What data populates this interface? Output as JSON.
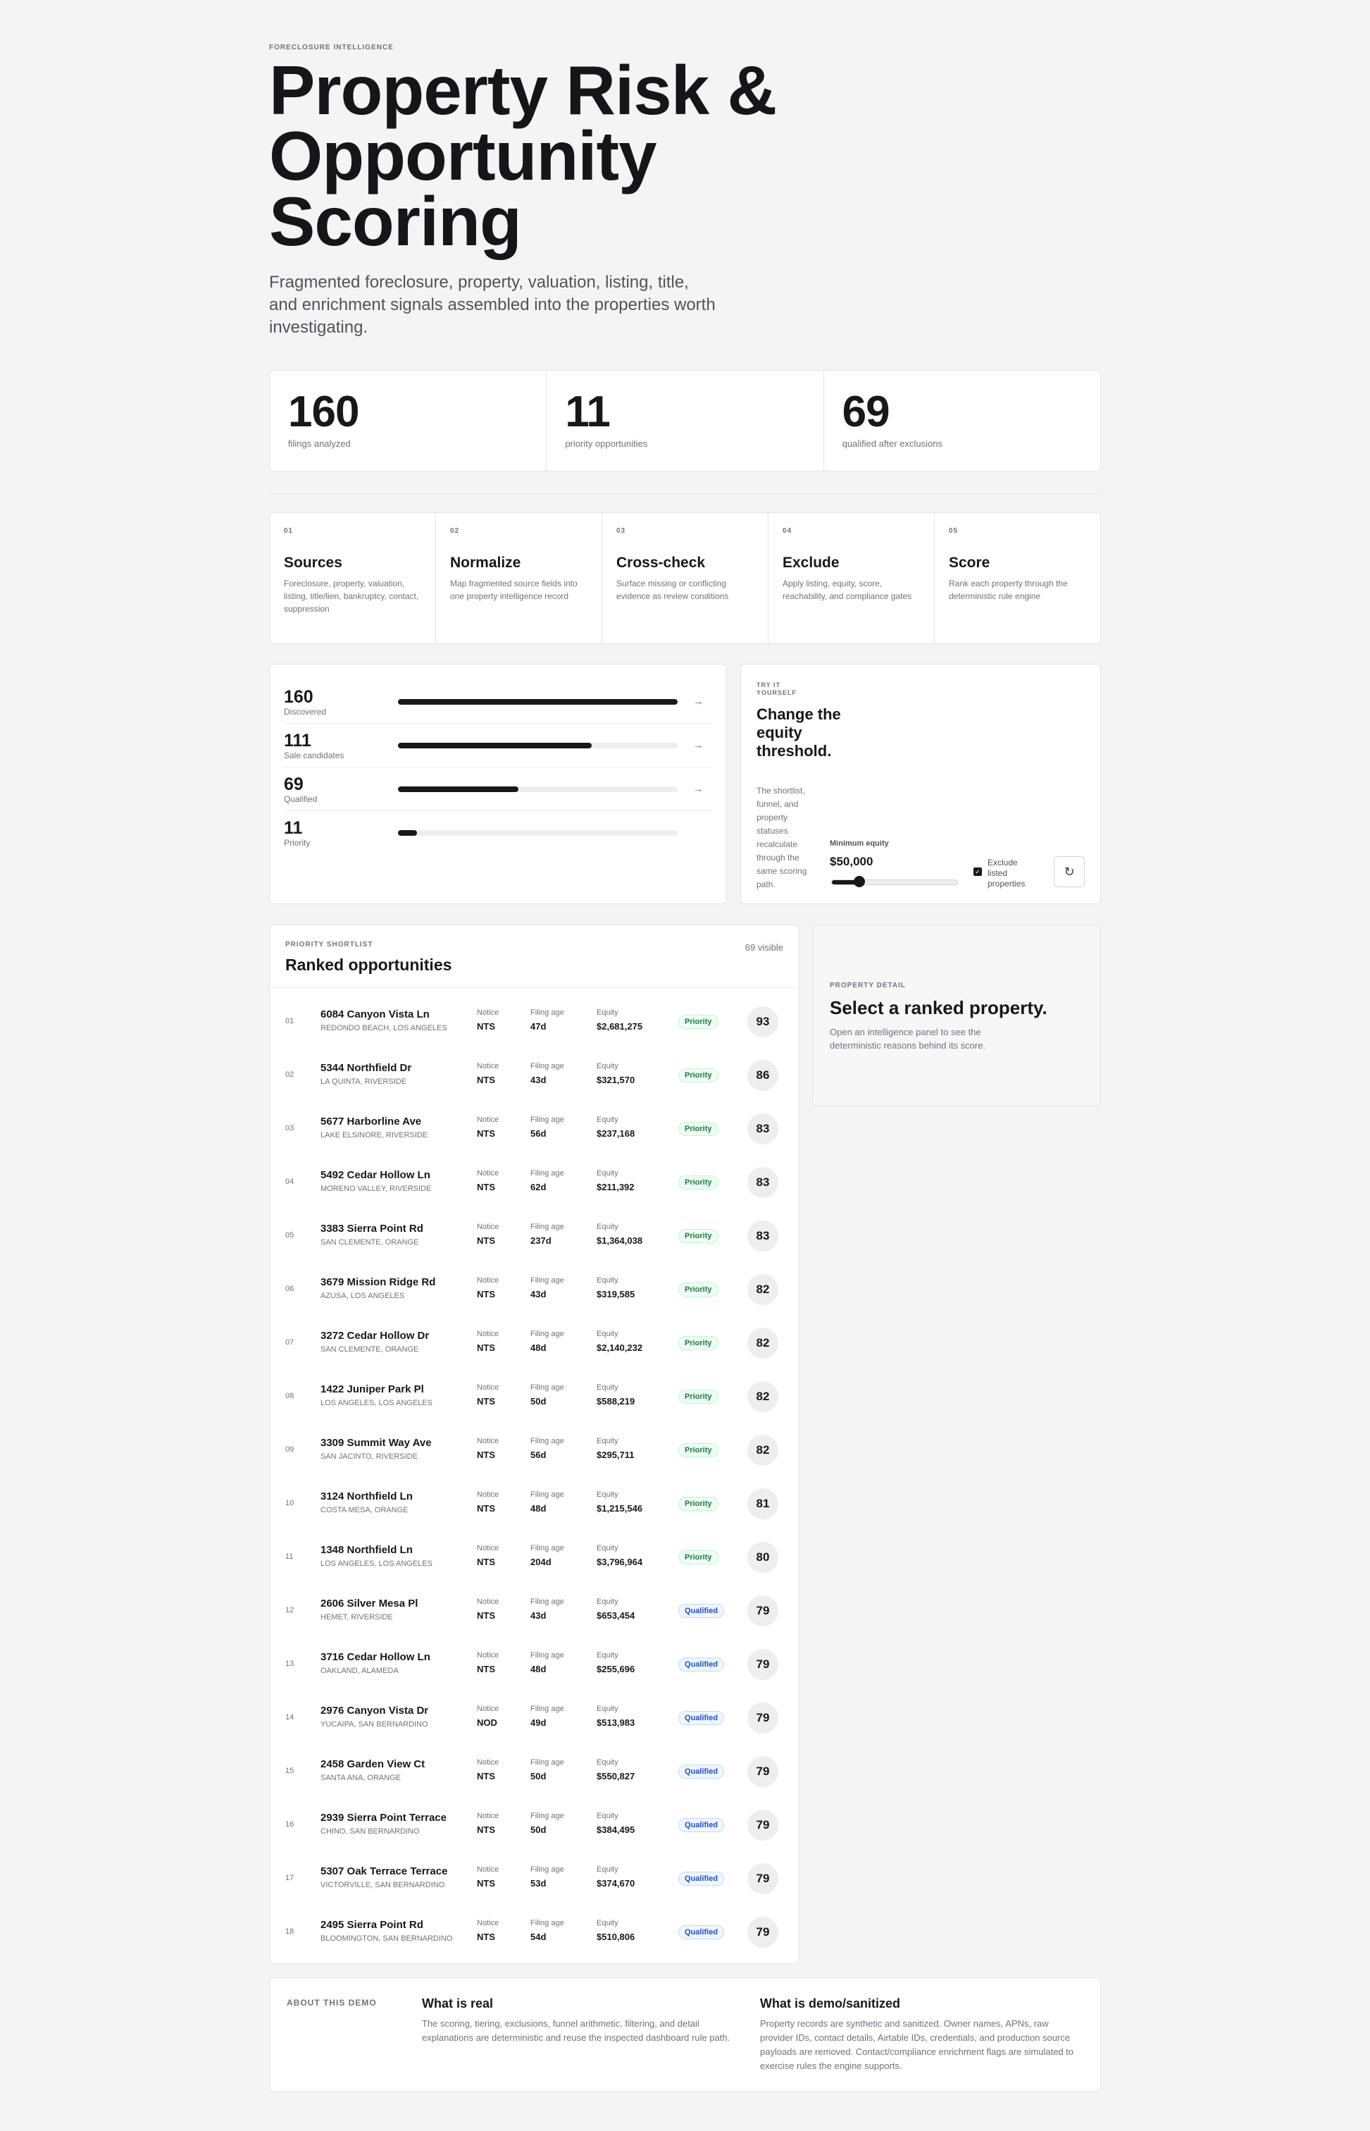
{
  "hero": {
    "kicker": "FORECLOSURE INTELLIGENCE",
    "title": "Property Risk & Opportunity Scoring",
    "subtitle": "Fragmented foreclosure, property, valuation, listing, title, and enrichment signals assembled into the properties worth investigating."
  },
  "stats": [
    {
      "value": "160",
      "label": "filings analyzed"
    },
    {
      "value": "11",
      "label": "priority opportunities"
    },
    {
      "value": "69",
      "label": "qualified after exclusions"
    }
  ],
  "steps": [
    {
      "num": "01",
      "title": "Sources",
      "desc": "Foreclosure, property, valuation, listing, title/lien, bankruptcy, contact, suppression"
    },
    {
      "num": "02",
      "title": "Normalize",
      "desc": "Map fragmented source fields into one property intelligence record"
    },
    {
      "num": "03",
      "title": "Cross-check",
      "desc": "Surface missing or conflicting evidence as review conditions"
    },
    {
      "num": "04",
      "title": "Exclude",
      "desc": "Apply listing, equity, score, reachability, and compliance gates"
    },
    {
      "num": "05",
      "title": "Score",
      "desc": "Rank each property through the deterministic rule engine"
    }
  ],
  "funnel": [
    {
      "value": "160",
      "label": "Discovered",
      "fraction": 1.0,
      "arrow": "→"
    },
    {
      "value": "111",
      "label": "Sale candidates",
      "fraction": 0.694,
      "arrow": "→"
    },
    {
      "value": "69",
      "label": "Qualified",
      "fraction": 0.431,
      "arrow": "→"
    },
    {
      "value": "11",
      "label": "Priority",
      "fraction": 0.069,
      "arrow": ""
    }
  ],
  "try": {
    "kicker": "TRY IT YOURSELF",
    "title": "Change the equity threshold.",
    "desc": "The shortlist, funnel, and property statuses recalculate through the same scoring path.",
    "equity_label": "Minimum equity",
    "equity_value": "$50,000",
    "slider_fraction": 0.22,
    "exclude_label": "Exclude listed properties",
    "exclude_checked": true,
    "reset_icon": "↻"
  },
  "shortlist": {
    "kicker": "PRIORITY SHORTLIST",
    "title": "Ranked opportunities",
    "visible": "69 visible",
    "col_notice": "Notice",
    "col_age": "Filing age",
    "col_equity": "Equity",
    "rows": [
      {
        "rank": "01",
        "address": "6084 Canyon Vista Ln",
        "city": "REDONDO BEACH, LOS ANGELES",
        "notice": "NTS",
        "age": "47d",
        "equity": "$2,681,275",
        "status": "Priority",
        "score": "93"
      },
      {
        "rank": "02",
        "address": "5344 Northfield Dr",
        "city": "LA QUINTA, RIVERSIDE",
        "notice": "NTS",
        "age": "43d",
        "equity": "$321,570",
        "status": "Priority",
        "score": "86"
      },
      {
        "rank": "03",
        "address": "5677 Harborline Ave",
        "city": "LAKE ELSINORE, RIVERSIDE",
        "notice": "NTS",
        "age": "56d",
        "equity": "$237,168",
        "status": "Priority",
        "score": "83"
      },
      {
        "rank": "04",
        "address": "5492 Cedar Hollow Ln",
        "city": "MORENO VALLEY, RIVERSIDE",
        "notice": "NTS",
        "age": "62d",
        "equity": "$211,392",
        "status": "Priority",
        "score": "83"
      },
      {
        "rank": "05",
        "address": "3383 Sierra Point Rd",
        "city": "SAN CLEMENTE, ORANGE",
        "notice": "NTS",
        "age": "237d",
        "equity": "$1,364,038",
        "status": "Priority",
        "score": "83"
      },
      {
        "rank": "06",
        "address": "3679 Mission Ridge Rd",
        "city": "AZUSA, LOS ANGELES",
        "notice": "NTS",
        "age": "43d",
        "equity": "$319,585",
        "status": "Priority",
        "score": "82"
      },
      {
        "rank": "07",
        "address": "3272 Cedar Hollow Dr",
        "city": "SAN CLEMENTE, ORANGE",
        "notice": "NTS",
        "age": "48d",
        "equity": "$2,140,232",
        "status": "Priority",
        "score": "82"
      },
      {
        "rank": "08",
        "address": "1422 Juniper Park Pl",
        "city": "LOS ANGELES, LOS ANGELES",
        "notice": "NTS",
        "age": "50d",
        "equity": "$588,219",
        "status": "Priority",
        "score": "82"
      },
      {
        "rank": "09",
        "address": "3309 Summit Way Ave",
        "city": "SAN JACINTO, RIVERSIDE",
        "notice": "NTS",
        "age": "56d",
        "equity": "$295,711",
        "status": "Priority",
        "score": "82"
      },
      {
        "rank": "10",
        "address": "3124 Northfield Ln",
        "city": "COSTA MESA, ORANGE",
        "notice": "NTS",
        "age": "48d",
        "equity": "$1,215,546",
        "status": "Priority",
        "score": "81"
      },
      {
        "rank": "11",
        "address": "1348 Northfield Ln",
        "city": "LOS ANGELES, LOS ANGELES",
        "notice": "NTS",
        "age": "204d",
        "equity": "$3,796,964",
        "status": "Priority",
        "score": "80"
      },
      {
        "rank": "12",
        "address": "2606 Silver Mesa Pl",
        "city": "HEMET, RIVERSIDE",
        "notice": "NTS",
        "age": "43d",
        "equity": "$653,454",
        "status": "Qualified",
        "score": "79"
      },
      {
        "rank": "13",
        "address": "3716 Cedar Hollow Ln",
        "city": "OAKLAND, ALAMEDA",
        "notice": "NTS",
        "age": "48d",
        "equity": "$255,696",
        "status": "Qualified",
        "score": "79"
      },
      {
        "rank": "14",
        "address": "2976 Canyon Vista Dr",
        "city": "YUCAIPA, SAN BERNARDINO",
        "notice": "NOD",
        "age": "49d",
        "equity": "$513,983",
        "status": "Qualified",
        "score": "79"
      },
      {
        "rank": "15",
        "address": "2458 Garden View Ct",
        "city": "SANTA ANA, ORANGE",
        "notice": "NTS",
        "age": "50d",
        "equity": "$550,827",
        "status": "Qualified",
        "score": "79"
      },
      {
        "rank": "16",
        "address": "2939 Sierra Point Terrace",
        "city": "CHINO, SAN BERNARDINO",
        "notice": "NTS",
        "age": "50d",
        "equity": "$384,495",
        "status": "Qualified",
        "score": "79"
      },
      {
        "rank": "17",
        "address": "5307 Oak Terrace Terrace",
        "city": "VICTORVILLE, SAN BERNARDINO",
        "notice": "NTS",
        "age": "53d",
        "equity": "$374,670",
        "status": "Qualified",
        "score": "79"
      },
      {
        "rank": "18",
        "address": "2495 Sierra Point Rd",
        "city": "BLOOMINGTON, SAN BERNARDINO",
        "notice": "NTS",
        "age": "54d",
        "equity": "$510,806",
        "status": "Qualified",
        "score": "79"
      }
    ]
  },
  "detail": {
    "kicker": "PROPERTY DETAIL",
    "title": "Select a ranked property.",
    "desc": "Open an intelligence panel to see the deterministic reasons behind its score."
  },
  "about": {
    "kicker": "ABOUT THIS DEMO",
    "real_title": "What is real",
    "real_desc": "The scoring, tiering, exclusions, funnel arithmetic, filtering, and detail explanations are deterministic and reuse the inspected dashboard rule path.",
    "demo_title": "What is demo/sanitized",
    "demo_desc": "Property records are synthetic and sanitized. Owner names, APNs, raw provider IDs, contact details, Airtable IDs, credentials, and production source payloads are removed. Contact/compliance enrichment flags are simulated to exercise rules the engine supports."
  }
}
